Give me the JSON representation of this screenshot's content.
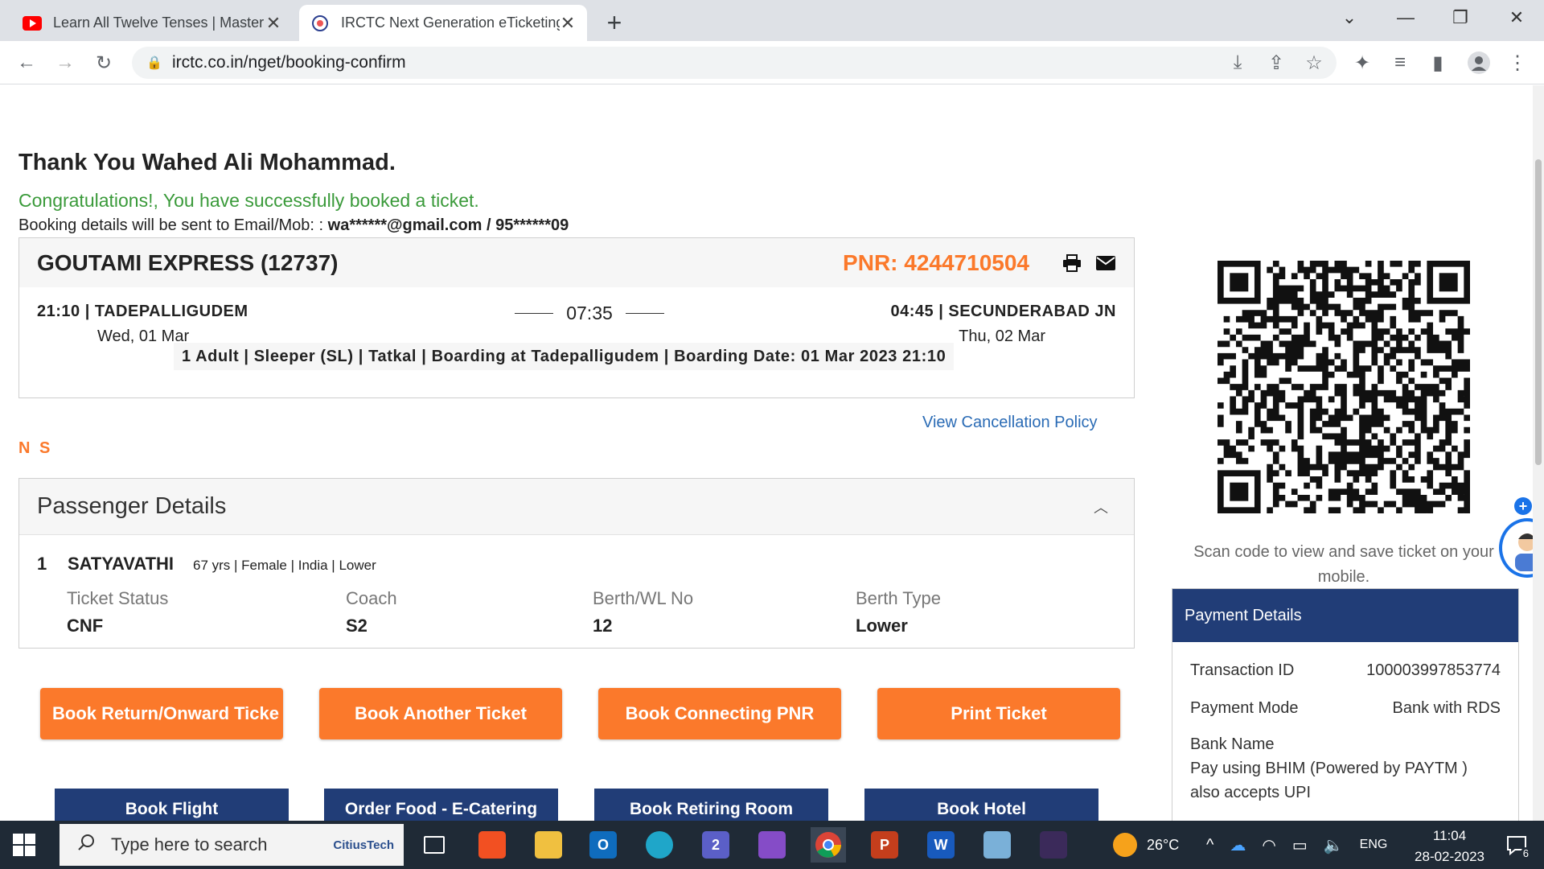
{
  "browser": {
    "tabs": [
      {
        "title": "Learn All Twelve Tenses | Master I",
        "active": false
      },
      {
        "title": "IRCTC Next Generation eTicketing",
        "active": true
      }
    ],
    "url": "irctc.co.in/nget/booking-confirm"
  },
  "page": {
    "thanks": "Thank You Wahed Ali Mohammad.",
    "congrats": "Congratulations!, You have successfully booked a ticket.",
    "booking_info_label": "Booking details will be sent to Email/Mob: : ",
    "booking_info_contact": "wa******@gmail.com / 95******09",
    "journey": {
      "train": "GOUTAMI EXPRESS (12737)",
      "pnr": "PNR: 4244710504",
      "from": "21:10 | TADEPALLIGUDEM",
      "from_date": "Wed, 01 Mar",
      "duration": "07:35",
      "to": "04:45 | SECUNDERABAD JN",
      "to_date": "Thu, 02 Mar",
      "info": "1 Adult | Sleeper (SL) | Tatkal | Boarding at Tadepalligudem | Boarding Date: 01 Mar 2023 21:10"
    },
    "cancellation_link": "View Cancellation Policy",
    "ns": "N S",
    "passenger": {
      "section_title": "Passenger Details",
      "num": "1",
      "name": "SATYAVATHI",
      "meta": "67 yrs | Female | India | Lower",
      "columns": [
        {
          "label": "Ticket Status",
          "value": "CNF"
        },
        {
          "label": "Coach",
          "value": "S2"
        },
        {
          "label": "Berth/WL No",
          "value": "12"
        },
        {
          "label": "Berth Type",
          "value": "Lower"
        }
      ]
    },
    "orange_buttons": [
      "Book Return/Onward Ticke",
      "Book Another Ticket",
      "Book Connecting PNR",
      "Print Ticket"
    ],
    "blue_buttons": [
      "Book Flight",
      "Order Food - E-Catering",
      "Book Retiring Room",
      "Book Hotel"
    ],
    "scan_text": "Scan code to view and save ticket on your mobile.",
    "payment": {
      "title": "Payment Details",
      "transaction_label": "Transaction ID",
      "transaction_value": "100003997853774",
      "mode_label": "Payment Mode",
      "mode_value": "Bank with RDS",
      "bank_label": "Bank Name",
      "bank_value": "Pay using BHIM (Powered by PAYTM ) also accepts UPI"
    }
  },
  "taskbar": {
    "search_placeholder": "Type here to search",
    "search_brand": "CitiusTech",
    "weather": "26°C",
    "lang": "ENG",
    "time": "11:04",
    "date": "28-02-2023",
    "notif_count": "6",
    "teams_badge": "2"
  },
  "colors": {
    "accent_orange": "#fb792b",
    "navy": "#213d77",
    "success_green": "#3a9a3a",
    "link_blue": "#2a6bb5"
  }
}
